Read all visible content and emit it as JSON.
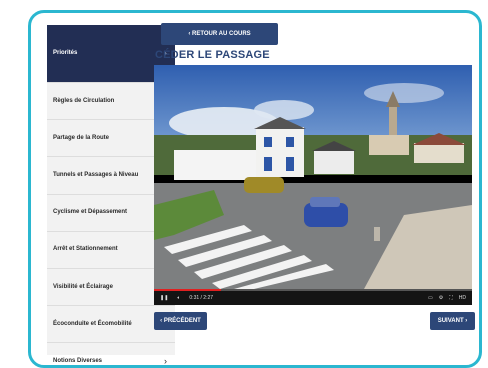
{
  "sidebar": {
    "items": [
      {
        "label": "Priorités",
        "active": true
      },
      {
        "label": "Règles de Circulation",
        "active": false
      },
      {
        "label": "Partage de la Route",
        "active": false
      },
      {
        "label": "Tunnels et Passages à Niveau",
        "active": false
      },
      {
        "label": "Cyclisme et Dépassement",
        "active": false
      },
      {
        "label": "Arrêt et Stationnement",
        "active": false
      },
      {
        "label": "Visibilité et Éclairage",
        "active": false
      },
      {
        "label": "Écoconduite et Écomobilité",
        "active": false
      },
      {
        "label": "Notions Diverses",
        "active": false
      }
    ],
    "chevron": "›"
  },
  "toolbar": {
    "back_label": "‹ RETOUR AU COURS"
  },
  "lesson": {
    "title": "CÉDER LE PASSAGE"
  },
  "player": {
    "time": "0:31 / 2:27",
    "progress": 0.21,
    "quality_badge": "HD"
  },
  "nav": {
    "previous_label": "‹ PRÉCÉDENT",
    "next_label": "SUIVANT ›"
  },
  "colors": {
    "accent": "#2bb7d0",
    "sidebar_active": "#222e54",
    "button": "#2d4778"
  }
}
